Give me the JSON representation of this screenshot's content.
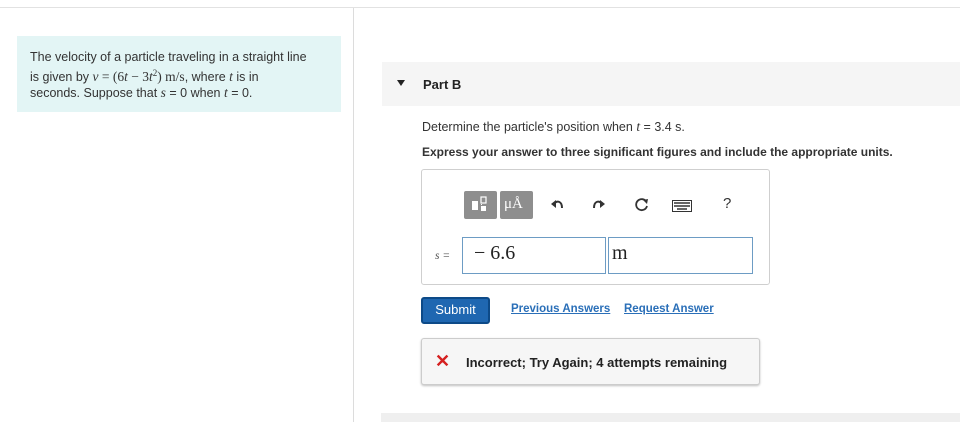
{
  "problem": {
    "text1": "The velocity of a particle traveling in a straight line",
    "text2a": "is given by ",
    "v_var": "v",
    "eq": " = (6",
    "t1": "t",
    "minus": " − 3",
    "t2": "t",
    "sup": "2",
    "close": ") ",
    "unit": "m/s",
    "where": ", where ",
    "t_var": "t",
    "isin": " is in",
    "text3a": "seconds. Suppose that ",
    "s_var": "s",
    "zero_when": " = 0 when ",
    "t_var2": "t",
    "end": " = 0."
  },
  "part": {
    "title": "Part B",
    "question_pre": "Determine the particle's position when ",
    "question_var": "t",
    "question_post": " = 3.4 s.",
    "instruction": "Express your answer to three significant figures and include the appropriate units."
  },
  "toolbar": {
    "units_label": "μÅ",
    "help_label": "?",
    "icons": [
      "templates-icon",
      "units-icon",
      "undo-icon",
      "redo-icon",
      "reset-icon",
      "keyboard-icon",
      "help-icon"
    ]
  },
  "answer": {
    "var_label": "s =",
    "value": "− 6.6",
    "unit": "m"
  },
  "actions": {
    "submit": "Submit",
    "previous": "Previous Answers",
    "request": "Request Answer"
  },
  "feedback": {
    "icon": "✕",
    "text": "Incorrect; Try Again; 4 attempts remaining"
  },
  "colors": {
    "problem_bg": "#e3f5f5",
    "submit_bg": "#1f67b1",
    "link": "#2a6fb8",
    "error": "#d52020"
  }
}
